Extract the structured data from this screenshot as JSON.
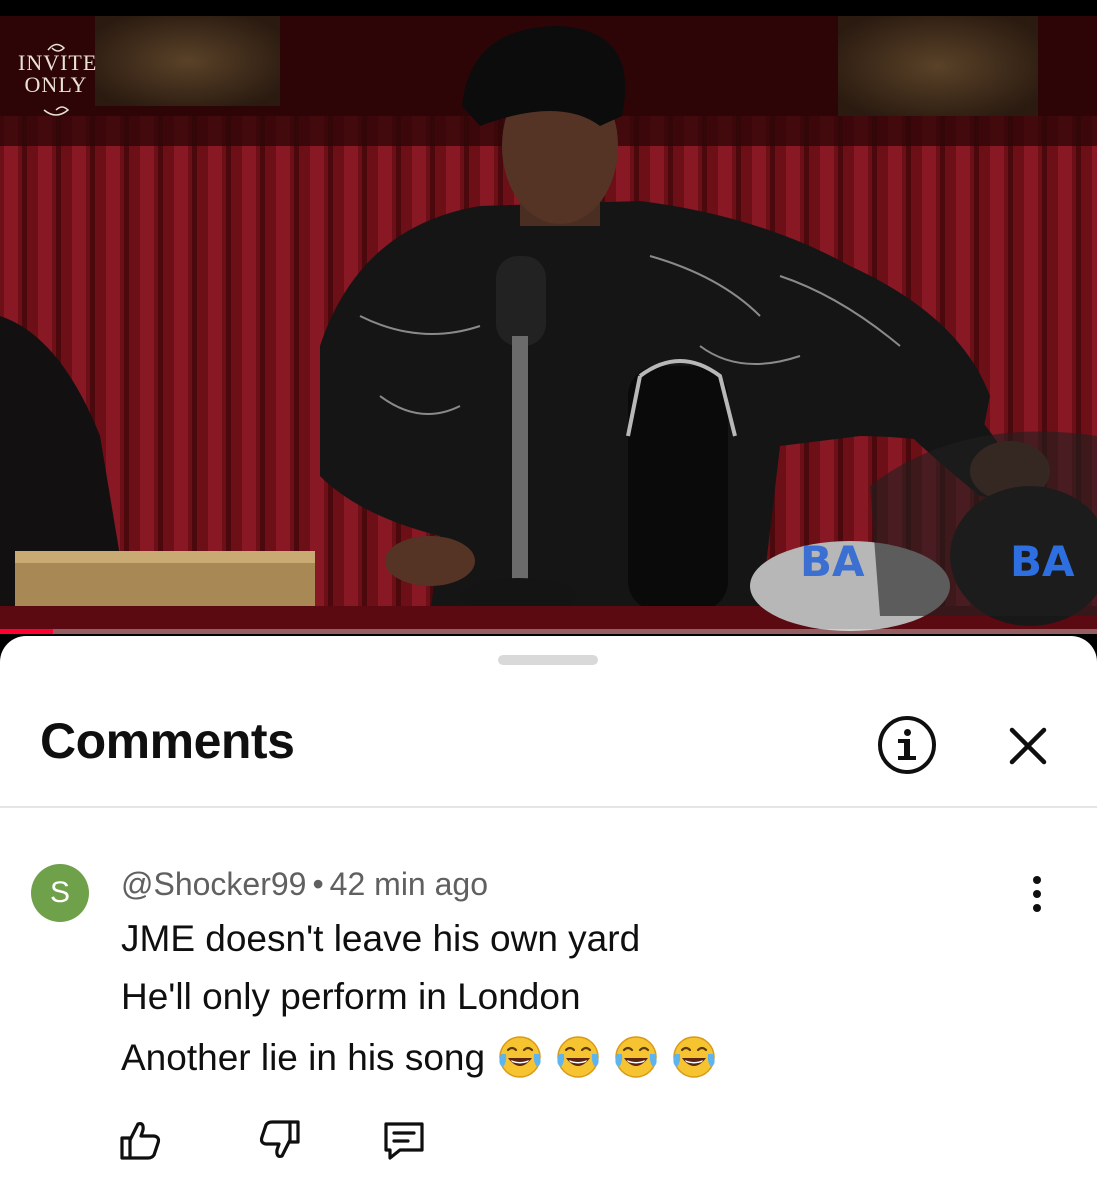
{
  "video": {
    "channel_logo_line1": "INVITE",
    "channel_logo_line2": "ONLY",
    "progress": 0.048,
    "progress_color": "#ff0033"
  },
  "comments_panel": {
    "title": "Comments",
    "info_icon": "info-circle-icon",
    "close_icon": "close-icon"
  },
  "comment": {
    "avatar_letter": "S",
    "avatar_color": "#6fa04a",
    "author": "@Shocker99",
    "separator": "•",
    "time": "42 min ago",
    "lines": [
      "JME doesn't leave his own yard",
      "He'll only perform in London",
      "Another lie in his song"
    ],
    "emojis": [
      "face-with-tears-of-joy",
      "face-with-tears-of-joy",
      "face-with-tears-of-joy",
      "face-with-tears-of-joy"
    ],
    "actions": [
      "thumbs-up-icon",
      "thumbs-down-icon",
      "reply-icon"
    ]
  }
}
